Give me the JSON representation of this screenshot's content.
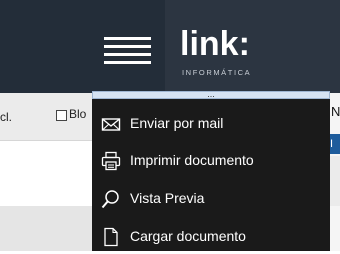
{
  "header": {
    "menu_icon": "hamburger-icon",
    "logo": {
      "word": "link:",
      "tagline": "INFORMÁTICA"
    }
  },
  "toolbar": {
    "cut_text": "cl.",
    "checkbox_label": "Blo"
  },
  "right_edge": {
    "letter_top": "N",
    "tab_label": "I"
  },
  "menu": {
    "handle_label": "...",
    "items": [
      {
        "label": "Enviar por mail",
        "icon": "envelope-icon"
      },
      {
        "label": "Imprimir documento",
        "icon": "printer-icon"
      },
      {
        "label": "Vista Previa",
        "icon": "magnifier-icon"
      },
      {
        "label": "Cargar documento",
        "icon": "document-icon"
      }
    ]
  },
  "colors": {
    "header_bg": "#232d39",
    "menu_bg": "#1a1a1a",
    "handle_bg": "#d6e3f3",
    "accent_tab": "#1e5c9c"
  }
}
